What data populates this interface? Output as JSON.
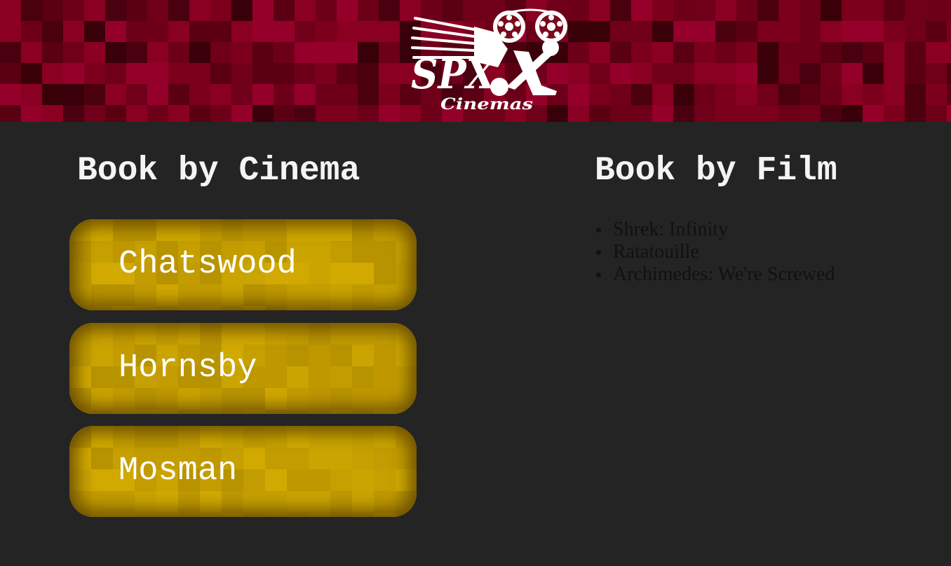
{
  "colors": {
    "header_base": "#6a0016",
    "background": "#242424",
    "button_gold": "#c9a200",
    "heading_text": "#f4f4f4",
    "list_text": "#111111"
  },
  "header": {
    "logo": {
      "icon": "film-reel-projector-icon",
      "brand": "SPX",
      "subtitle": "Cinemas"
    }
  },
  "book_by_cinema": {
    "heading": "Book by Cinema",
    "cinemas": [
      {
        "label": "Chatswood"
      },
      {
        "label": "Hornsby"
      },
      {
        "label": "Mosman"
      }
    ]
  },
  "book_by_film": {
    "heading": "Book by Film",
    "films": [
      {
        "title": "Shrek: Infinity"
      },
      {
        "title": "Ratatouille"
      },
      {
        "title": "Archimedes: We're Screwed"
      }
    ]
  }
}
